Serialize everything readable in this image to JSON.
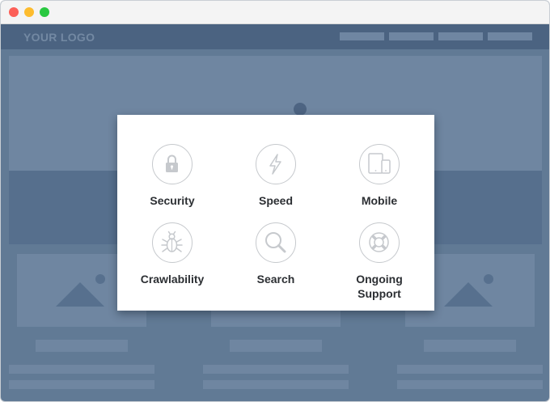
{
  "window": {
    "buttons": [
      "close",
      "minimize",
      "zoom"
    ]
  },
  "site": {
    "logo_text": "YOUR LOGO",
    "nav_items": 4
  },
  "features": [
    {
      "label": "Security",
      "icon": "lock-icon"
    },
    {
      "label": "Speed",
      "icon": "lightning-icon"
    },
    {
      "label": "Mobile",
      "icon": "devices-icon"
    },
    {
      "label": "Crawlability",
      "icon": "bug-icon"
    },
    {
      "label": "Search",
      "icon": "search-icon"
    },
    {
      "label": "Ongoing Support",
      "icon": "lifebuoy-icon"
    }
  ],
  "colors": {
    "page_bg": "#617a95",
    "nav_bg": "#4b6381",
    "placeholder": "#6f86a1",
    "modal_bg": "#ffffff",
    "icon_stroke": "#c6c9cd",
    "label_text": "#2c2f33"
  }
}
